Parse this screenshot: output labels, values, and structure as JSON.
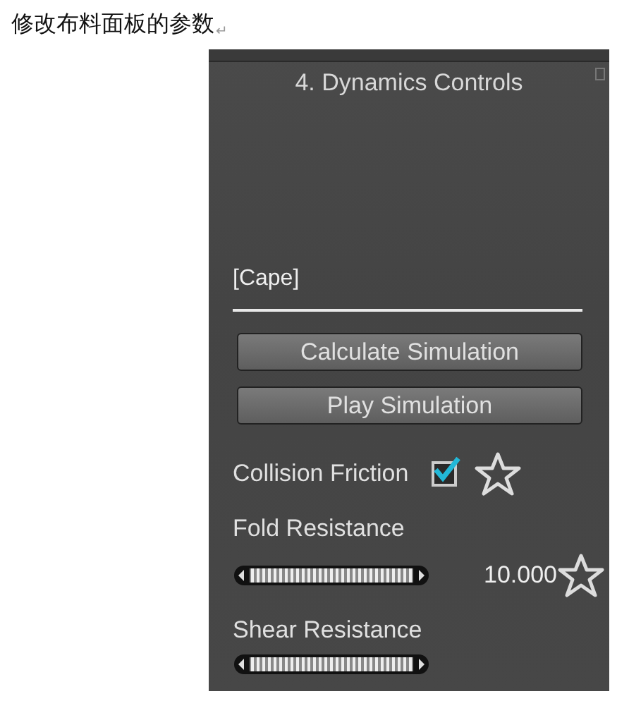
{
  "heading": {
    "text": "修改布料面板的参数",
    "mark": "↵"
  },
  "panel": {
    "title": "4. Dynamics Controls",
    "object": "[Cape]",
    "buttons": [
      "Calculate Simulation",
      "Play Simulation"
    ],
    "controls": [
      {
        "kind": "checkbox",
        "label": "Collision Friction",
        "checked": true
      },
      {
        "kind": "dial",
        "label": "Fold Resistance",
        "reading": "10.000"
      },
      {
        "kind": "dial",
        "label": "Shear Resistance"
      }
    ]
  }
}
